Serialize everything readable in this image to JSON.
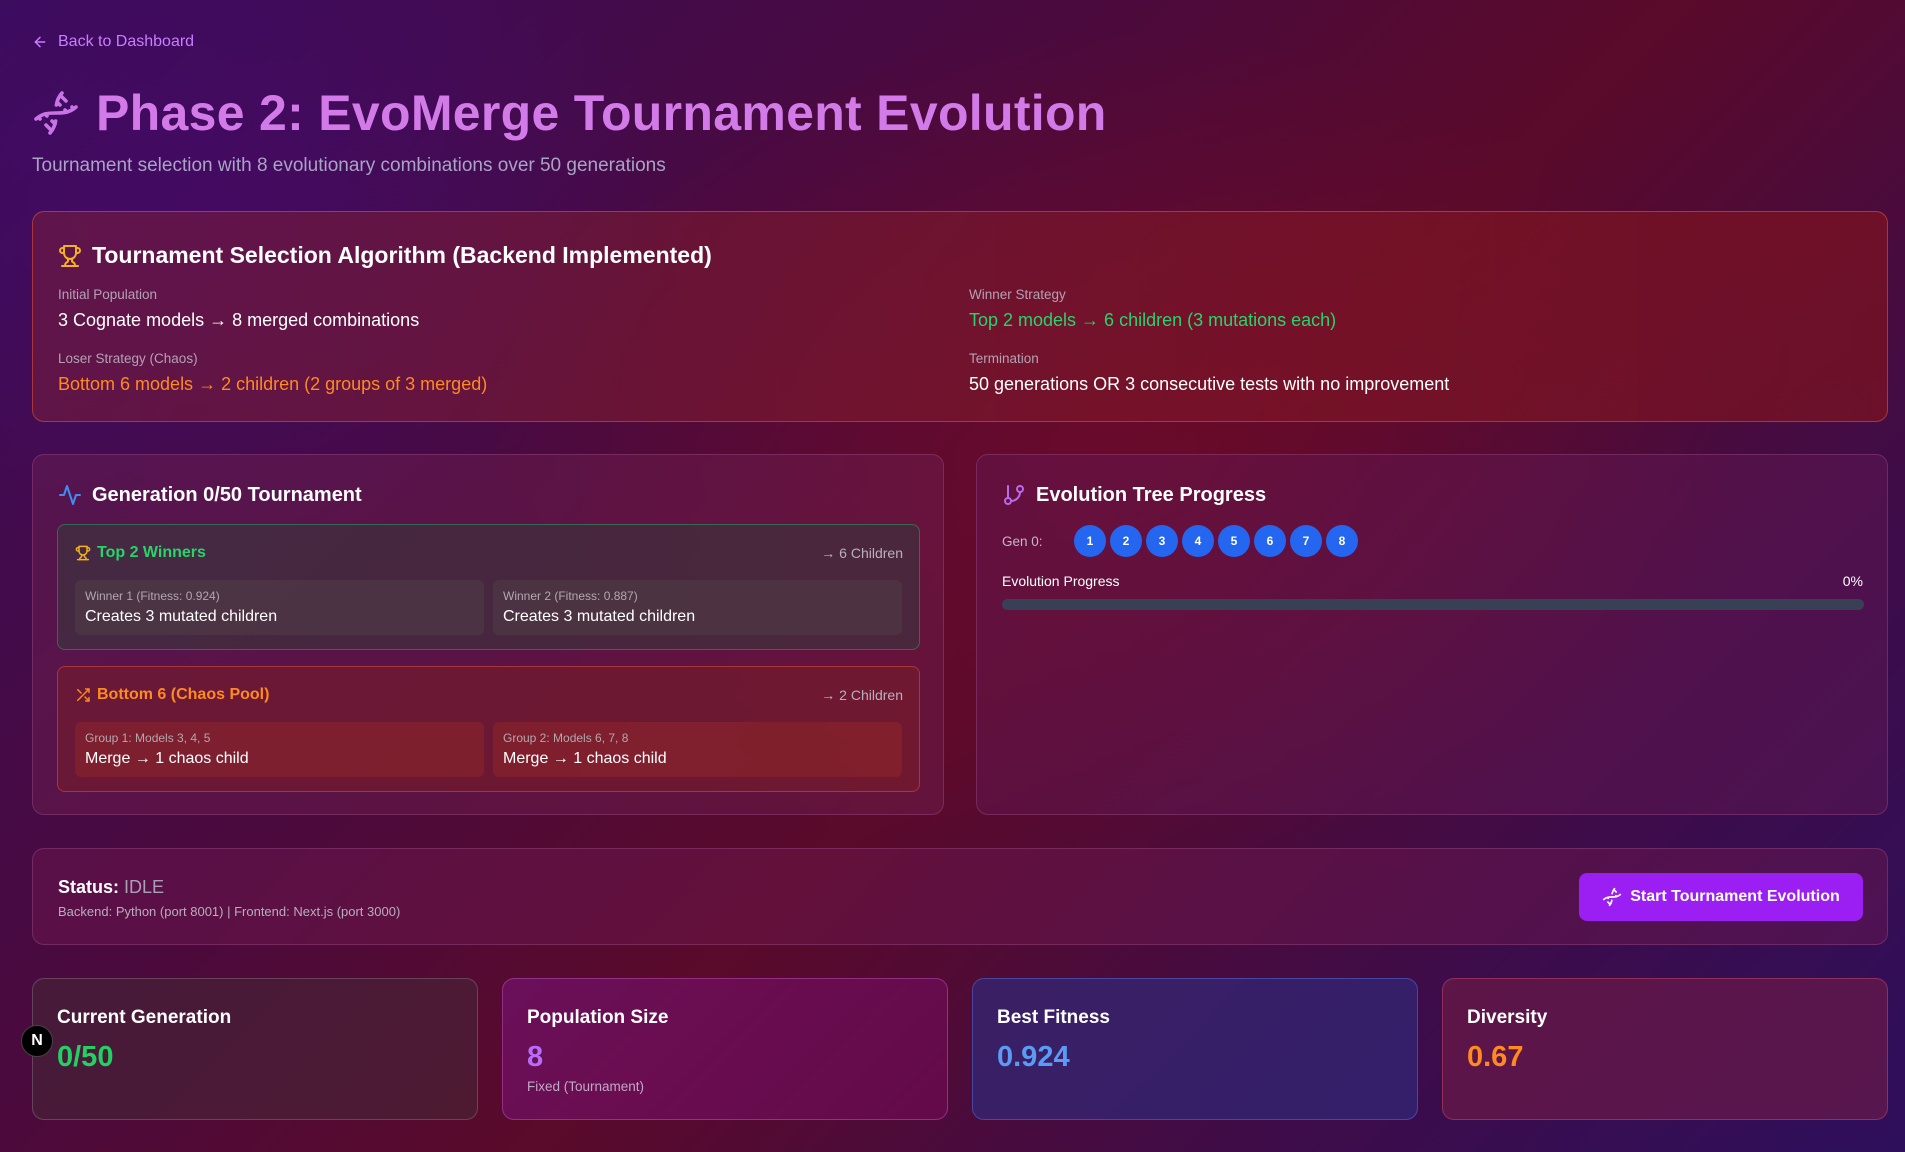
{
  "nav": {
    "back_label": "Back to Dashboard"
  },
  "header": {
    "title": "Phase 2: EvoMerge Tournament Evolution",
    "subtitle": "Tournament selection with 8 evolutionary combinations over 50 generations"
  },
  "algorithm": {
    "title": "Tournament Selection Algorithm (Backend Implemented)",
    "initial_label": "Initial Population",
    "initial_value": "3 Cognate models → 8 merged combinations",
    "winner_label": "Winner Strategy",
    "winner_value": "Top 2 models → 6 children (3 mutations each)",
    "loser_label": "Loser Strategy (Chaos)",
    "loser_value": "Bottom 6 models → 2 children (2 groups of 3 merged)",
    "termination_label": "Termination",
    "termination_value": "50 generations OR 3 consecutive tests with no improvement"
  },
  "generation": {
    "title": "Generation 0/50 Tournament",
    "winners": {
      "title": "Top 2 Winners",
      "children": "→ 6 Children",
      "items": [
        {
          "label": "Winner 1 (Fitness: 0.924)",
          "value": "Creates 3 mutated children"
        },
        {
          "label": "Winner 2 (Fitness: 0.887)",
          "value": "Creates 3 mutated children"
        }
      ]
    },
    "chaos": {
      "title": "Bottom 6 (Chaos Pool)",
      "children": "→ 2 Children",
      "items": [
        {
          "label": "Group 1: Models 3, 4, 5",
          "value": "Merge → 1 chaos child"
        },
        {
          "label": "Group 2: Models 6, 7, 8",
          "value": "Merge → 1 chaos child"
        }
      ]
    }
  },
  "tree": {
    "title": "Evolution Tree Progress",
    "gen_label": "Gen 0:",
    "nodes": [
      "1",
      "2",
      "3",
      "4",
      "5",
      "6",
      "7",
      "8"
    ],
    "progress_label": "Evolution Progress",
    "progress_text": "0%",
    "progress_value": 0
  },
  "status": {
    "label": "Status:",
    "value": "IDLE",
    "details": "Backend: Python (port 8001) | Frontend: Next.js (port 3000)",
    "start_label": "Start Tournament Evolution"
  },
  "stats": [
    {
      "label": "Current Generation",
      "value": "0/50",
      "sub": "",
      "color": "#22d162"
    },
    {
      "label": "Population Size",
      "value": "8",
      "sub": "Fixed (Tournament)",
      "color": "#b66cf5"
    },
    {
      "label": "Best Fitness",
      "value": "0.924",
      "sub": "",
      "color": "#5b9bf5"
    },
    {
      "label": "Diversity",
      "value": "0.67",
      "sub": "",
      "color": "#ff8a1f"
    }
  ],
  "next_badge": "N",
  "colors": {
    "accent_purple": "#d27ae8",
    "green": "#28d46a",
    "orange": "#ff8a1f",
    "node_blue": "#2466f0",
    "button": "#9b1ef2"
  }
}
